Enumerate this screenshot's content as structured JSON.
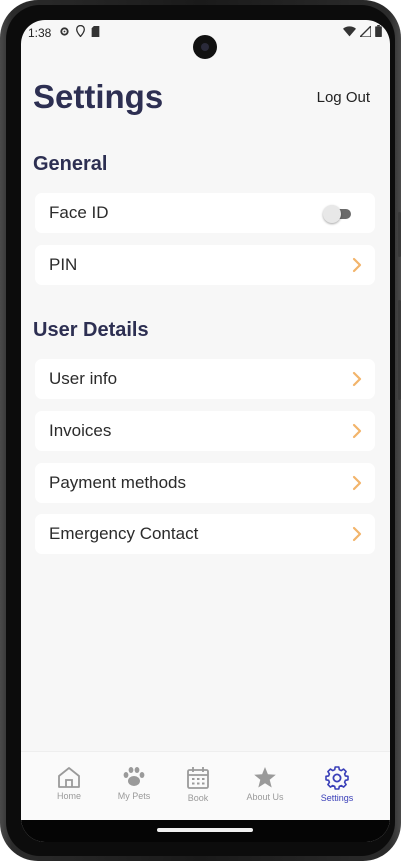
{
  "status_bar": {
    "time": "1:38"
  },
  "header": {
    "title": "Settings",
    "logout_label": "Log Out"
  },
  "sections": {
    "general": {
      "title": "General",
      "items": [
        {
          "label": "Face ID",
          "control": "toggle",
          "toggle_on": false
        },
        {
          "label": "PIN",
          "control": "chevron"
        }
      ]
    },
    "user_details": {
      "title": "User Details",
      "items": [
        {
          "label": "User info",
          "control": "chevron"
        },
        {
          "label": "Invoices",
          "control": "chevron"
        },
        {
          "label": "Payment methods",
          "control": "chevron"
        },
        {
          "label": "Emergency Contact",
          "control": "chevron"
        }
      ]
    }
  },
  "tab_bar": {
    "active": "Settings",
    "tabs": [
      {
        "label": "Home",
        "icon": "home-icon"
      },
      {
        "label": "My Pets",
        "icon": "paw-icon"
      },
      {
        "label": "Book",
        "icon": "calendar-icon"
      },
      {
        "label": "About Us",
        "icon": "star-icon"
      },
      {
        "label": "Settings",
        "icon": "gear-icon"
      }
    ]
  },
  "colors": {
    "title": "#2d2f52",
    "chevron": "#f2b46b",
    "active_tab": "#3a3fb8",
    "inactive_tab": "#9a9a9a",
    "background": "#f7f7f7"
  }
}
